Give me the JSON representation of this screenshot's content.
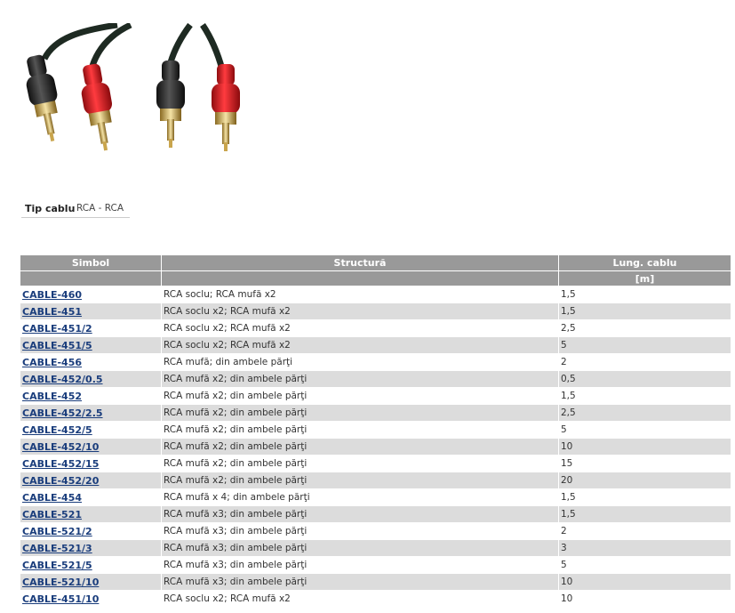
{
  "spec": {
    "label": "Tip cablu",
    "value": "RCA - RCA"
  },
  "table": {
    "headers": {
      "symbol": "Simbol",
      "structure": "Structură",
      "length": "Lung. cablu",
      "length_unit": "[m]"
    },
    "rows": [
      {
        "symbol": "CABLE-460",
        "structure": "RCA soclu; RCA mufă x2",
        "length": "1,5"
      },
      {
        "symbol": "CABLE-451",
        "structure": "RCA soclu x2; RCA mufă x2",
        "length": "1,5"
      },
      {
        "symbol": "CABLE-451/2",
        "structure": "RCA soclu x2; RCA mufă x2",
        "length": "2,5"
      },
      {
        "symbol": "CABLE-451/5",
        "structure": "RCA soclu x2; RCA mufă x2",
        "length": "5"
      },
      {
        "symbol": "CABLE-456",
        "structure": "RCA mufă; din ambele părţi",
        "length": "2"
      },
      {
        "symbol": "CABLE-452/0.5",
        "structure": "RCA mufă x2; din ambele părţi",
        "length": "0,5"
      },
      {
        "symbol": "CABLE-452",
        "structure": "RCA mufă x2; din ambele părţi",
        "length": "1,5"
      },
      {
        "symbol": "CABLE-452/2.5",
        "structure": "RCA mufă x2; din ambele părţi",
        "length": "2,5"
      },
      {
        "symbol": "CABLE-452/5",
        "structure": "RCA mufă x2; din ambele părţi",
        "length": "5"
      },
      {
        "symbol": "CABLE-452/10",
        "structure": "RCA mufă x2; din ambele părţi",
        "length": "10"
      },
      {
        "symbol": "CABLE-452/15",
        "structure": "RCA mufă x2; din ambele părţi",
        "length": "15"
      },
      {
        "symbol": "CABLE-452/20",
        "structure": "RCA mufă x2; din ambele părţi",
        "length": "20"
      },
      {
        "symbol": "CABLE-454",
        "structure": "RCA mufă x 4; din ambele părţi",
        "length": "1,5"
      },
      {
        "symbol": "CABLE-521",
        "structure": "RCA mufă x3; din ambele părţi",
        "length": "1,5"
      },
      {
        "symbol": "CABLE-521/2",
        "structure": "RCA mufă x3; din ambele părţi",
        "length": "2"
      },
      {
        "symbol": "CABLE-521/3",
        "structure": "RCA mufă x3; din ambele părţi",
        "length": "3"
      },
      {
        "symbol": "CABLE-521/5",
        "structure": "RCA mufă x3; din ambele părţi",
        "length": "5"
      },
      {
        "symbol": "CABLE-521/10",
        "structure": "RCA mufă x3; din ambele părţi",
        "length": "10"
      },
      {
        "symbol": "CABLE-451/10",
        "structure": "RCA soclu x2; RCA mufă x2",
        "length": "10"
      }
    ]
  },
  "colors": {
    "header_bg": "#999999",
    "row_alt_bg": "#dcdcdc",
    "link": "#1a3d7c",
    "plug_red": "#d8232a",
    "plug_black": "#2a2a2a"
  }
}
